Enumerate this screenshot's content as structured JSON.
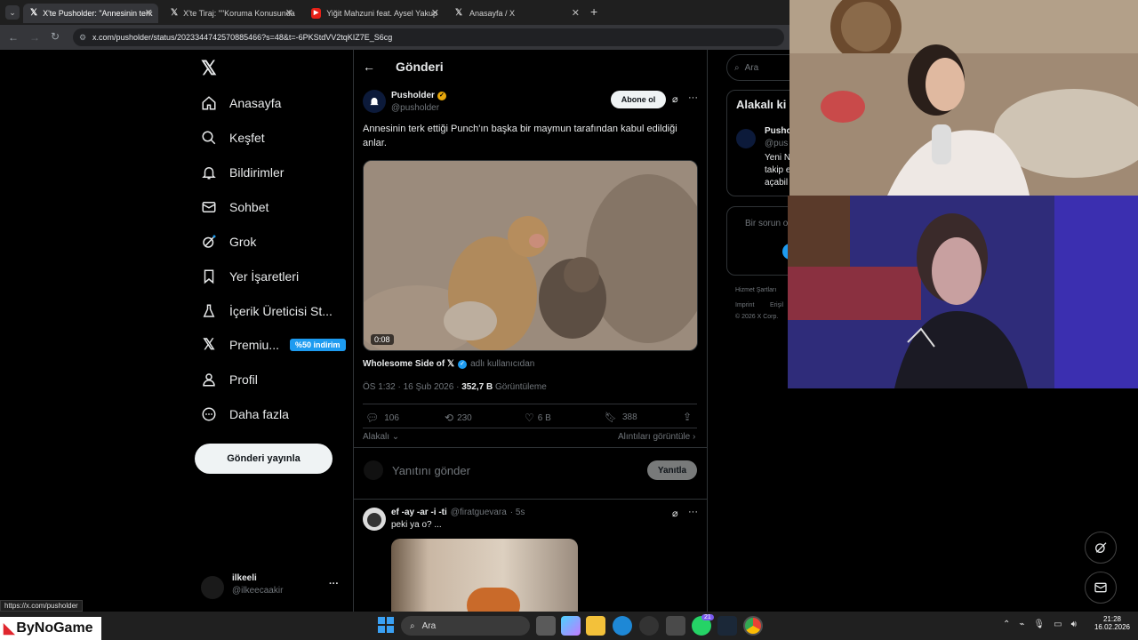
{
  "browser": {
    "tabs": [
      {
        "label": "X'te Pusholder: \"Annesinin terk",
        "active": true
      },
      {
        "label": "X'te Tiraj: \"\"Koruma Konusunda",
        "active": false
      },
      {
        "label": "Yiğit Mahzuni feat. Aysel Yakup",
        "active": false
      },
      {
        "label": "Anasayfa / X",
        "active": false
      }
    ],
    "url": "x.com/pusholder/status/2023344742570885466?s=48&t=-6PKStdVV2tqKIZ7E_S6cg",
    "status_url": "https://x.com/pusholder"
  },
  "sidebar": {
    "items": [
      {
        "label": "Anasayfa",
        "icon": "home-icon"
      },
      {
        "label": "Keşfet",
        "icon": "search-icon"
      },
      {
        "label": "Bildirimler",
        "icon": "bell-icon"
      },
      {
        "label": "Sohbet",
        "icon": "mail-icon"
      },
      {
        "label": "Grok",
        "icon": "grok-icon"
      },
      {
        "label": "Yer İşaretleri",
        "icon": "bookmark-icon"
      },
      {
        "label": "İçerik Üreticisi St...",
        "icon": "flask-icon"
      },
      {
        "label": "Premiu...",
        "icon": "x-icon",
        "badge": "%50 indirim"
      },
      {
        "label": "Profil",
        "icon": "person-icon"
      },
      {
        "label": "Daha fazla",
        "icon": "more-circle-icon"
      }
    ],
    "post_button": "Gönderi yayınla",
    "account": {
      "name": "ilkeeli",
      "handle": "@ilkeecaakir",
      "more": "···"
    }
  },
  "post": {
    "header_title": "Gönderi",
    "author_name": "Pusholder",
    "author_handle": "@pusholder",
    "follow_label": "Abone ol",
    "text": "Annesinin terk ettiği Punch'ın başka bir maymun tarafından kabul edildiği anlar.",
    "video_duration": "0:08",
    "source_name": "Wholesome Side of 𝕏",
    "source_suffix": "adlı kullanıcıdan",
    "timestamp": "ÖS 1:32 · 16 Şub 2026 ·",
    "views": "352,7 B",
    "views_label": "Görüntüleme",
    "stats": {
      "replies": "106",
      "reposts": "230",
      "likes": "6 B",
      "bookmarks": "388"
    },
    "sort_label": "Alakalı",
    "quotes_link": "Alıntıları görüntüle",
    "reply_placeholder": "Yanıtını gönder",
    "reply_button": "Yanıtla"
  },
  "reply": {
    "name": "ef -ay -ar -i -ti",
    "handle": "@firatguevara",
    "time": "· 5s",
    "text": "peki ya o? ..."
  },
  "right": {
    "search_placeholder": "Ara",
    "relevant_title": "Alakalı ki",
    "card_name": "Pusho",
    "card_handle": "@pus",
    "card_text": [
      "Yeni N",
      "takip e",
      "açabil"
    ],
    "issue_text": "Bir sorun o",
    "footer": [
      "Hizmet Şartları",
      "Imprint",
      "Erişil",
      "© 2026 X Corp."
    ]
  },
  "taskbar": {
    "search": "Ara",
    "time": "21:28",
    "date": "16.02.2026",
    "watermark": "ByNoGame",
    "badge_count": "21"
  }
}
